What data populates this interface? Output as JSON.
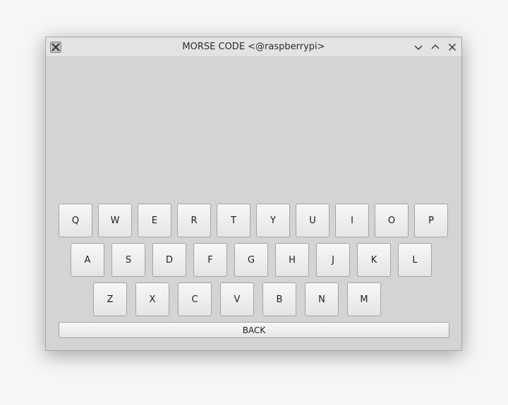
{
  "window": {
    "title": "MORSE CODE <@raspberrypi>"
  },
  "keyboard": {
    "row1": [
      "Q",
      "W",
      "E",
      "R",
      "T",
      "Y",
      "U",
      "I",
      "O",
      "P"
    ],
    "row2": [
      "A",
      "S",
      "D",
      "F",
      "G",
      "H",
      "J",
      "K",
      "L"
    ],
    "row3": [
      "Z",
      "X",
      "C",
      "V",
      "B",
      "N",
      "M"
    ],
    "back_label": "BACK"
  }
}
